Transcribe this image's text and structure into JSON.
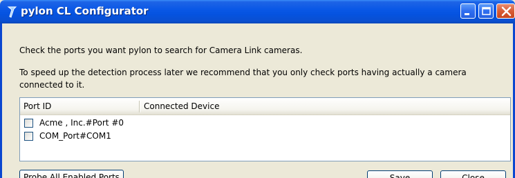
{
  "window": {
    "title": "pylon CL Configurator",
    "accent_color": "#0a58e6",
    "title_icon": "pylon-app-icon",
    "controls": {
      "minimize_icon": "minimize-icon",
      "maximize_icon": "maximize-icon",
      "close_icon": "close-icon"
    }
  },
  "instructions": {
    "line1": "Check the ports you want pylon to search for Camera Link cameras.",
    "line2": "To speed up the detection process later we recommend that you only check ports having actually a camera",
    "line3": "connected to it."
  },
  "port_list": {
    "columns": [
      "Port ID",
      "Connected Device"
    ],
    "rows": [
      {
        "port_id": "Acme , Inc.#Port #0",
        "connected_device": "",
        "checked": false
      },
      {
        "port_id": "COM_Port#COM1",
        "connected_device": "",
        "checked": false
      }
    ]
  },
  "buttons": {
    "probe": "Probe All Enabled Ports",
    "save": "Save",
    "close": "Close"
  }
}
